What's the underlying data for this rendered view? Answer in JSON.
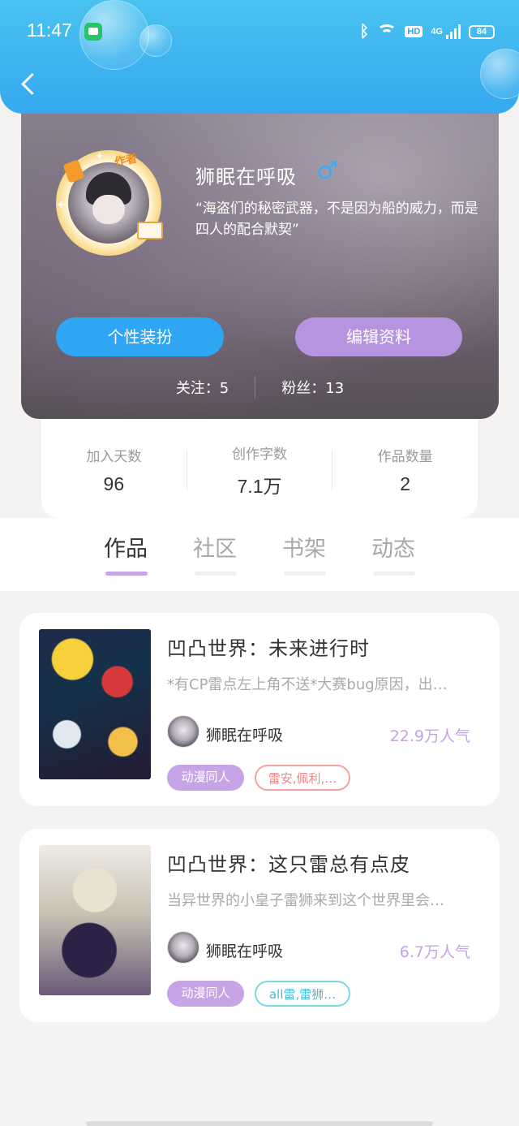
{
  "status_bar": {
    "time": "11:47",
    "battery": "84",
    "hd": "HD",
    "network": "4G"
  },
  "profile": {
    "username": "狮眠在呼吸",
    "gender_symbol": "♂",
    "author_tag": "作者",
    "bio": "“海盗们的秘密武器，不是因为船的威力，而是四人的配合默契”",
    "buttons": {
      "dress_up": "个性装扮",
      "edit_profile": "编辑资料"
    },
    "follow": "关注：5",
    "fans": "粉丝：13"
  },
  "stats": [
    {
      "label": "加入天数",
      "value": "96"
    },
    {
      "label": "创作字数",
      "value": "7.1万"
    },
    {
      "label": "作品数量",
      "value": "2"
    }
  ],
  "tabs": [
    {
      "label": "作品",
      "active": true
    },
    {
      "label": "社区",
      "active": false
    },
    {
      "label": "书架",
      "active": false
    },
    {
      "label": "动态",
      "active": false
    }
  ],
  "works": [
    {
      "title": "凹凸世界：未来进行时",
      "description": "*有CP雷点左上角不送*大赛bug原因，出…",
      "author": "狮眠在呼吸",
      "popularity": "22.9万人气",
      "tags": [
        "动漫同人",
        "雷安,佩利,…"
      ]
    },
    {
      "title": "凹凸世界：这只雷总有点皮",
      "description": "当异世界的小皇子雷狮来到这个世界里会…",
      "author": "狮眠在呼吸",
      "popularity": "6.7万人气",
      "tags": [
        "动漫同人",
        "all雷,雷狮…"
      ]
    }
  ],
  "colors": {
    "header_blue": "#35a8ef",
    "dress_button": "#2fa6f3",
    "edit_button": "#b694e0",
    "popularity_purple": "#c4a4e4",
    "tab_indicator": "#c7a7e6"
  }
}
